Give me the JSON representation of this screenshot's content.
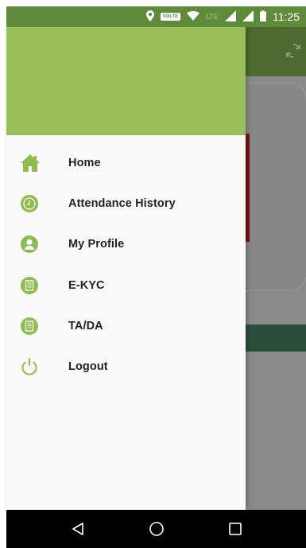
{
  "status_bar": {
    "time": "11:25",
    "volte_label": "VOLTE",
    "lte_label": "LTE",
    "icons": [
      "location-icon",
      "volte-icon",
      "wifi-icon",
      "signal-icon",
      "signal-icon",
      "battery-icon"
    ]
  },
  "drawer": {
    "header_color": "#98bf59",
    "menu": [
      {
        "label": "Home",
        "icon": "home-icon"
      },
      {
        "label": "Attendance History",
        "icon": "clock-icon"
      },
      {
        "label": "My Profile",
        "icon": "profile-icon"
      },
      {
        "label": "E-KYC",
        "icon": "document-icon"
      },
      {
        "label": "TA/DA",
        "icon": "document-icon"
      },
      {
        "label": "Logout",
        "icon": "power-icon"
      }
    ]
  },
  "background_app": {
    "toolbar_icon": "refresh-icon"
  },
  "nav_bar": {
    "buttons": [
      "back-icon",
      "home-circle-icon",
      "recents-icon"
    ]
  },
  "colors": {
    "accent": "#98bf59",
    "icon_green": "#8ebc4f",
    "status_bar": "#5f8a3a"
  }
}
